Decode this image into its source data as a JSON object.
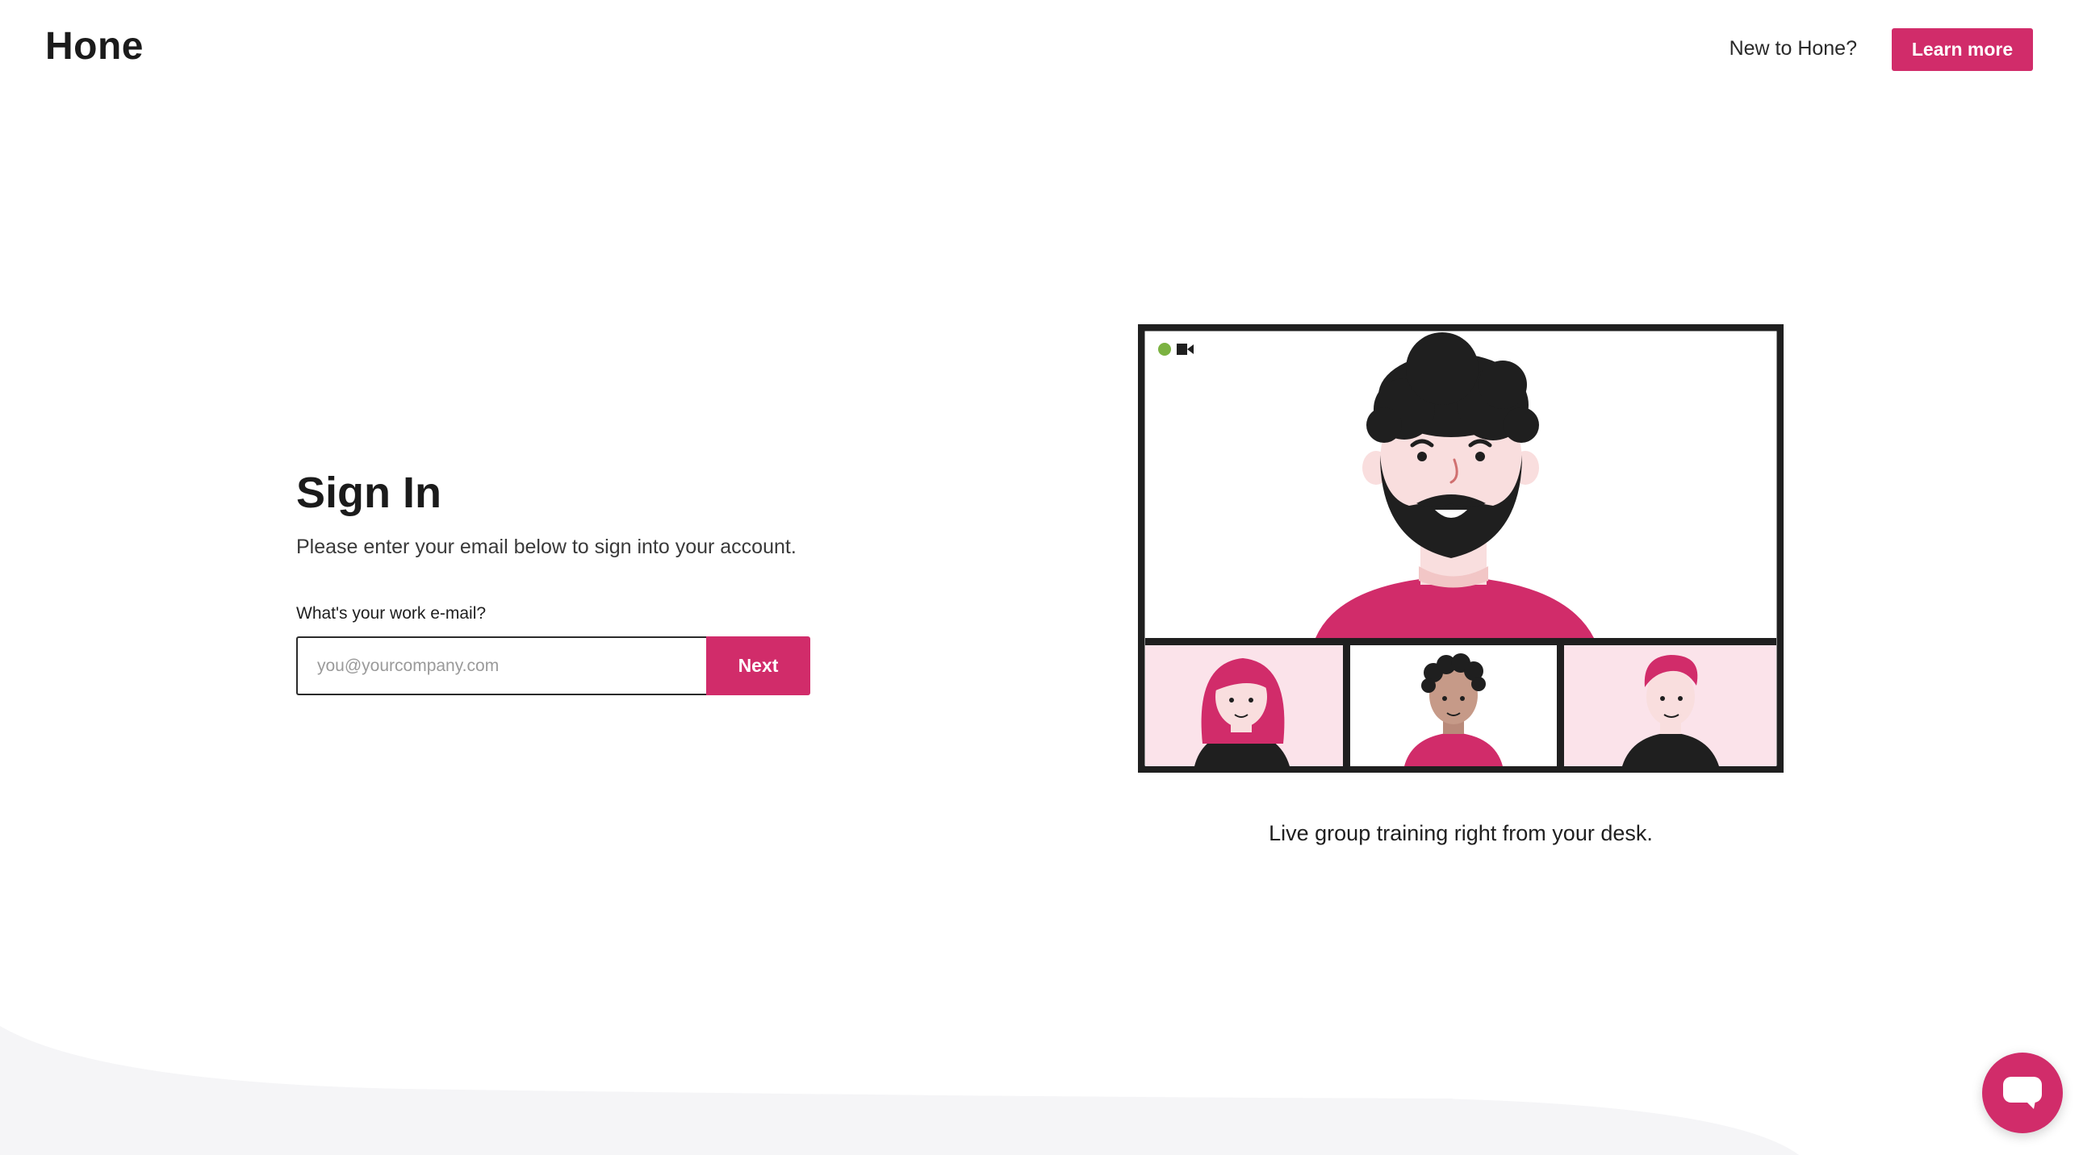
{
  "header": {
    "logo": "Hone",
    "new_to_text": "New to Hone?",
    "learn_more_label": "Learn more"
  },
  "signin": {
    "title": "Sign In",
    "subtitle": "Please enter your email below to sign into your account.",
    "email_label": "What's your work e-mail?",
    "email_placeholder": "you@yourcompany.com",
    "email_value": "",
    "next_label": "Next"
  },
  "illustration": {
    "caption": "Live group training right from your desk.",
    "status_dot_color": "#7bb241",
    "icon": "video-call-illustration"
  },
  "colors": {
    "accent": "#d12c6a",
    "text": "#1f1f1f",
    "footer_wave": "#f5f5f7"
  },
  "chat": {
    "icon": "chat-bubble-icon"
  }
}
